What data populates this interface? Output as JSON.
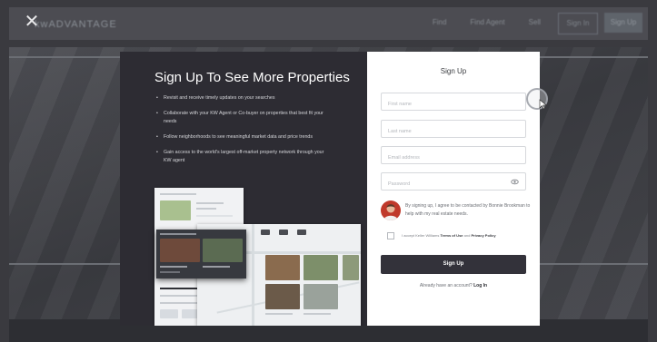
{
  "background": {
    "logo_text": "kwADVANTAGE",
    "nav": [
      "Find",
      "Find Agent",
      "Sell"
    ],
    "signin_label": "Sign In",
    "signup_label": "Sign Up"
  },
  "close_icon": "close-icon",
  "modal": {
    "left": {
      "title": "Sign Up To See More Properties",
      "benefits": [
        "Revisit and receive timely updates on your searches",
        "Collaborate with your KW Agent or Co-buyer on properties that best fit your needs",
        "Follow neighborhoods to see meaningful market data and price trends",
        "Gain access to the world's largest off-market property network through your KW agent"
      ]
    },
    "right": {
      "title": "Sign Up",
      "fields": {
        "first_name_placeholder": "First name",
        "last_name_placeholder": "Last name",
        "email_placeholder": "Email address",
        "password_placeholder": "Password"
      },
      "agent_text": "By signing up, I agree to be contacted by Bonnie Brookman to help with my real estate needs.",
      "consent_prefix": "I accept Keller Williams",
      "terms_label": "Terms of Use",
      "consent_and": "and",
      "privacy_label": "Privacy Policy",
      "submit_label": "Sign Up",
      "login_prefix": "Already have an account?",
      "login_label": "Log In"
    }
  },
  "colors": {
    "left_panel": "#2d2c33",
    "button": "#33323a",
    "overlay_bg": "#3a3a3f"
  }
}
